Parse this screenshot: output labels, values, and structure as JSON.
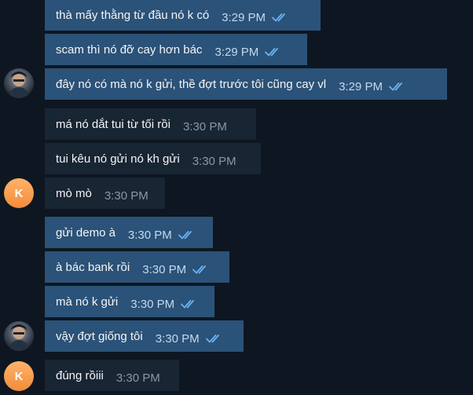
{
  "messages": [
    {
      "text": "thà mấy thằng từ đầu nó k có",
      "time": "3:29 PM"
    },
    {
      "text": "scam thì nó đỡ cay hơn bác",
      "time": "3:29 PM"
    },
    {
      "text": "đây nó có mà nó k gửi, thề đợt trước tôi cũng cay vl",
      "time": "3:29 PM"
    },
    {
      "text": "má nó dắt tui từ tối rồi",
      "time": "3:30 PM"
    },
    {
      "text": "tui kêu nó gửi nó kh gửi",
      "time": "3:30 PM"
    },
    {
      "text": "mò mò",
      "time": "3:30 PM"
    },
    {
      "text": "gửi demo à",
      "time": "3:30 PM"
    },
    {
      "text": "à bác bank rồi",
      "time": "3:30 PM"
    },
    {
      "text": "mà nó k gửi",
      "time": "3:30 PM"
    },
    {
      "text": "vậy đợt giống tôi",
      "time": "3:30 PM"
    },
    {
      "text": "đúng rồiii",
      "time": "3:30 PM"
    }
  ],
  "avatars": [
    {
      "letter": ""
    },
    {
      "letter": "K"
    },
    {
      "letter": ""
    },
    {
      "letter": "K"
    }
  ],
  "colors": {
    "background": "#0e1621",
    "outgoing_bubble": "#2b5278",
    "incoming_bubble": "#182533",
    "read_check": "#6ab3f3",
    "letter_avatar": "#f28b3a"
  },
  "icons": {
    "read_receipt": "double-check-icon"
  }
}
